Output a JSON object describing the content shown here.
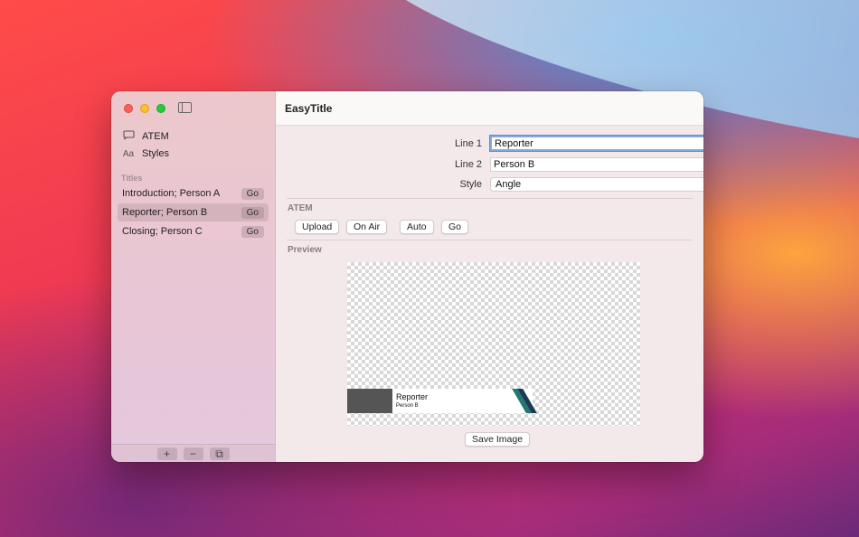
{
  "window": {
    "app_title": "EasyTitle"
  },
  "sidebar": {
    "nav": [
      {
        "icon": "display-icon",
        "label": "ATEM"
      },
      {
        "icon": "text-style-icon",
        "icon_text": "Aa",
        "label": "Styles"
      }
    ],
    "titles_section_label": "Titles",
    "titles": [
      {
        "label": "Introduction; Person A",
        "go": "Go",
        "selected": false
      },
      {
        "label": "Reporter; Person B",
        "go": "Go",
        "selected": true
      },
      {
        "label": "Closing; Person C",
        "go": "Go",
        "selected": false
      }
    ],
    "bottom_buttons": {
      "add": "+",
      "remove": "−",
      "duplicate": "⧉"
    }
  },
  "form": {
    "line1_label": "Line 1",
    "line1_value": "Reporter",
    "line2_label": "Line 2",
    "line2_value": "Person B",
    "style_label": "Style",
    "style_value": "Angle"
  },
  "atem": {
    "section_label": "ATEM",
    "upload": "Upload",
    "on_air": "On Air",
    "auto": "Auto",
    "go": "Go"
  },
  "preview": {
    "section_label": "Preview",
    "lower_third_line1": "Reporter",
    "lower_third_line2": "Person B",
    "save_image": "Save Image",
    "colors": {
      "block": "#555555",
      "stripe_teal": "#1f7a72",
      "stripe_dark": "#1a3a56"
    }
  }
}
